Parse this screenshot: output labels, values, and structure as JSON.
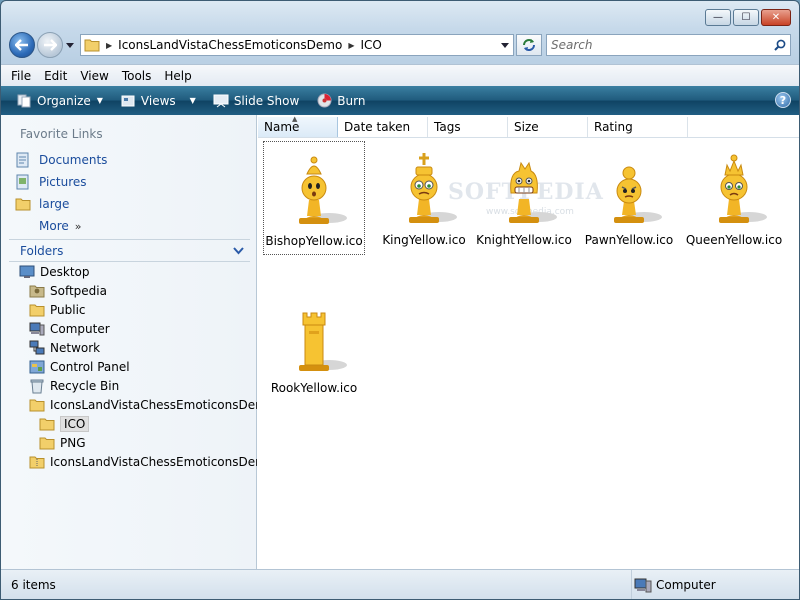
{
  "window": {
    "caption_buttons": {
      "minimize": "—",
      "maximize": "☐",
      "close": "✕"
    }
  },
  "address": {
    "segments": [
      "IconsLandVistaChessEmoticonsDemo",
      "ICO"
    ],
    "separator": "▶"
  },
  "search": {
    "placeholder": "Search"
  },
  "menu": [
    "File",
    "Edit",
    "View",
    "Tools",
    "Help"
  ],
  "toolbar": {
    "organize": "Organize",
    "views": "Views",
    "slideshow": "Slide Show",
    "burn": "Burn",
    "help": "?"
  },
  "favorites": {
    "title": "Favorite Links",
    "items": [
      "Documents",
      "Pictures",
      "large"
    ],
    "more": "More",
    "more_chevron": "»"
  },
  "folders": {
    "title": "Folders",
    "tree": [
      {
        "label": "Desktop",
        "icon": "desktop-icon"
      },
      {
        "label": "Softpedia",
        "icon": "user-folder-icon"
      },
      {
        "label": "Public",
        "icon": "folder-icon"
      },
      {
        "label": "Computer",
        "icon": "computer-icon"
      },
      {
        "label": "Network",
        "icon": "network-icon"
      },
      {
        "label": "Control Panel",
        "icon": "control-panel-icon"
      },
      {
        "label": "Recycle Bin",
        "icon": "recycle-bin-icon"
      },
      {
        "label": "IconsLandVistaChessEmoticonsDemo",
        "icon": "folder-icon"
      },
      {
        "label": "ICO",
        "icon": "folder-icon",
        "selected": true
      },
      {
        "label": "PNG",
        "icon": "folder-icon"
      },
      {
        "label": "IconsLandVistaChessEmoticonsDemo.z",
        "icon": "zip-folder-icon"
      }
    ]
  },
  "columns": [
    "Name",
    "Date taken",
    "Tags",
    "Size",
    "Rating"
  ],
  "files": [
    {
      "name": "BishopYellow.ico",
      "piece": "bishop"
    },
    {
      "name": "KingYellow.ico",
      "piece": "king"
    },
    {
      "name": "KnightYellow.ico",
      "piece": "knight"
    },
    {
      "name": "PawnYellow.ico",
      "piece": "pawn"
    },
    {
      "name": "QueenYellow.ico",
      "piece": "queen"
    },
    {
      "name": "RookYellow.ico",
      "piece": "rook"
    }
  ],
  "watermark": {
    "main": "SOFTPEDIA",
    "sub": "www.softpedia.com"
  },
  "status": {
    "count": "6 items",
    "location": "Computer"
  },
  "colors": {
    "accent": "#1a4c9c",
    "command_bar": "#1f5a7c",
    "piece": "#f3b21c"
  }
}
